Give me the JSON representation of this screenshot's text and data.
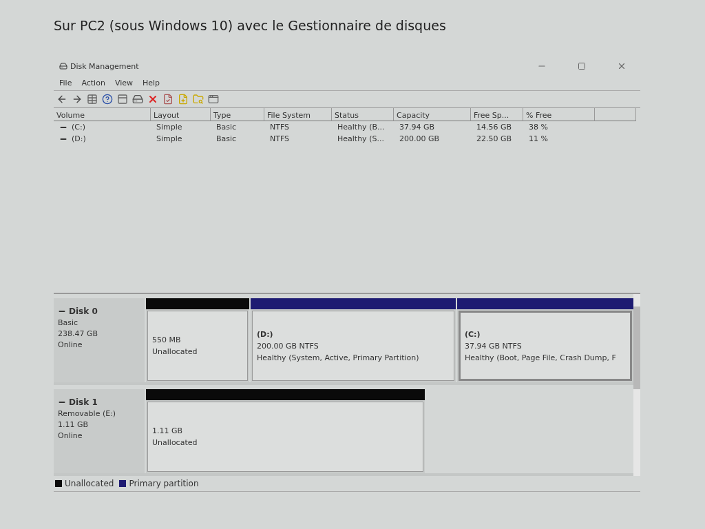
{
  "heading": "Sur PC2 (sous Windows 10) avec le Gestionnaire de disques",
  "window": {
    "title": "Disk Management",
    "menu": [
      "File",
      "Action",
      "View",
      "Help"
    ],
    "table": {
      "columns": [
        "Volume",
        "Layout",
        "Type",
        "File System",
        "Status",
        "Capacity",
        "Free Sp...",
        "% Free"
      ],
      "rows": [
        [
          "(C:)",
          "Simple",
          "Basic",
          "NTFS",
          "Healthy (B...",
          "37.94 GB",
          "14.56 GB",
          "38 %"
        ],
        [
          "(D:)",
          "Simple",
          "Basic",
          "NTFS",
          "Healthy (S...",
          "200.00 GB",
          "22.50 GB",
          "11 %"
        ]
      ]
    },
    "disks": [
      {
        "name": "Disk 0",
        "lines": [
          "Basic",
          "238.47 GB",
          "Online"
        ],
        "partitions": [
          {
            "color": "#0a0a0a",
            "lines": [
              "550 MB",
              "Unallocated"
            ],
            "selected": false
          },
          {
            "color": "#1e1b72",
            "title": "(D:)",
            "lines": [
              "200.00 GB NTFS",
              "Healthy (System, Active, Primary Partition)"
            ],
            "selected": false
          },
          {
            "color": "#1e1b72",
            "title": "(C:)",
            "lines": [
              "37.94 GB NTFS",
              "Healthy (Boot, Page File, Crash Dump, F"
            ],
            "selected": true
          }
        ]
      },
      {
        "name": "Disk 1",
        "lines": [
          "Removable (E:)",
          "1.11 GB",
          "Online"
        ],
        "partitions": [
          {
            "color": "#0a0a0a",
            "lines": [
              "1.11 GB",
              "Unallocated"
            ],
            "selected": false
          }
        ]
      }
    ],
    "legend": [
      {
        "label": "Unallocated",
        "color": "#0a0a0a"
      },
      {
        "label": "Primary partition",
        "color": "#1e1b72"
      }
    ]
  }
}
